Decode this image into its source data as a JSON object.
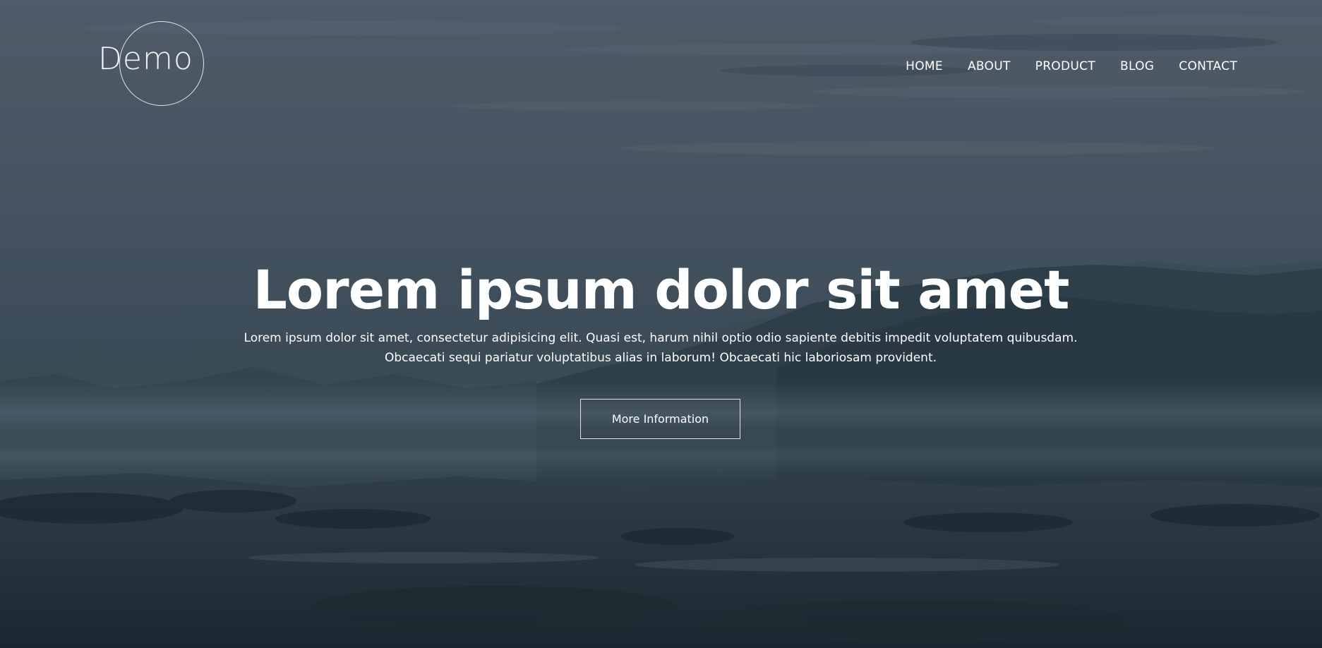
{
  "logo": {
    "text": "Demo"
  },
  "nav": {
    "items": [
      {
        "label": "HOME"
      },
      {
        "label": "ABOUT"
      },
      {
        "label": "PRODUCT"
      },
      {
        "label": "BLOG"
      },
      {
        "label": "CONTACT"
      }
    ]
  },
  "hero": {
    "title": "Lorem ipsum dolor sit amet",
    "subtext_line1": "Lorem ipsum dolor sit amet, consectetur adipisicing elit. Quasi est, harum nihil optio odio sapiente debitis impedit voluptatem quibusdam.",
    "subtext_line2": "Obcaecati sequi pariatur voluptatibus alias in laborum! Obcaecati hic laboriosam provident.",
    "cta_label": "More Information",
    "background_icon": "mountain-landscape-photo"
  },
  "colors": {
    "text": "#ffffff",
    "overlay": "#2f3e4a"
  }
}
